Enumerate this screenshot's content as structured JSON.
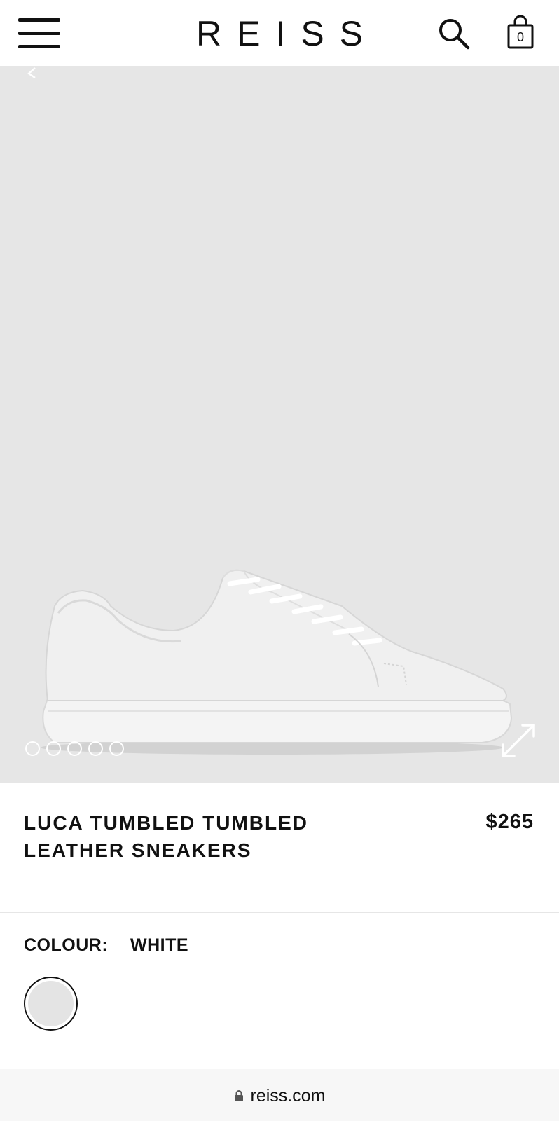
{
  "header": {
    "logo": "REISS",
    "menu_icon": "hamburger-menu-icon",
    "search_icon": "search-icon",
    "bag_icon": "shopping-bag-icon",
    "bag_count": "0"
  },
  "gallery": {
    "image": "white-leather-sneaker-side-view",
    "background": "#e6e6e6",
    "dots_total": 5,
    "prev_icon": "chevron-left-icon",
    "expand_icon": "expand-arrows-icon"
  },
  "product": {
    "title": "LUCA TUMBLED TUMBLED LEATHER SNEAKERS",
    "price": "$265"
  },
  "colour": {
    "label": "COLOUR:",
    "value": "WHITE",
    "swatch_color": "#e4e4e4"
  },
  "browser": {
    "url": "reiss.com",
    "lock_icon": "lock-icon"
  }
}
